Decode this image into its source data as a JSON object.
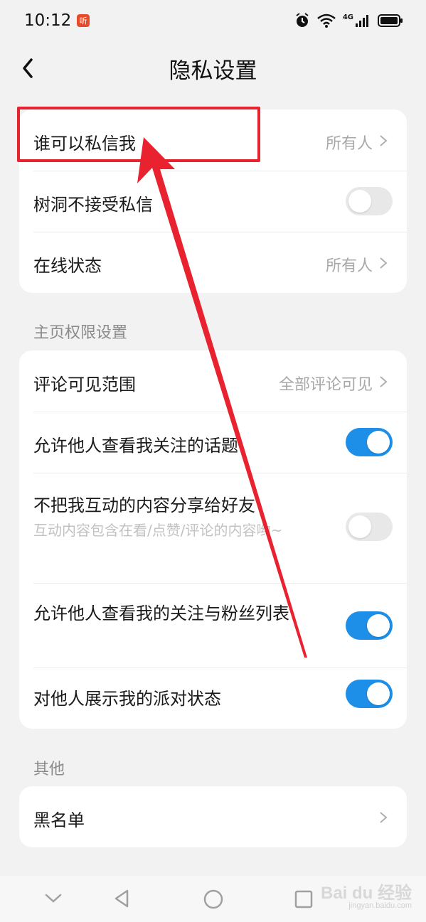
{
  "status_bar": {
    "time": "10:12",
    "notif_badge": "听",
    "network": "4G"
  },
  "header": {
    "title": "隐私设置"
  },
  "card1": {
    "who_can_message": {
      "label": "谁可以私信我",
      "value": "所有人"
    },
    "treehole": {
      "label": "树洞不接受私信",
      "toggle": "off"
    },
    "online_status": {
      "label": "在线状态",
      "value": "所有人"
    }
  },
  "section_homepage": "主页权限设置",
  "card2": {
    "comment_visibility": {
      "label": "评论可见范围",
      "value": "全部评论可见"
    },
    "allow_view_topics": {
      "label": "允许他人查看我关注的话题",
      "toggle": "on"
    },
    "no_share_interactions": {
      "label": "不把我互动的内容分享给好友",
      "sub": "互动内容包含在看/点赞/评论的内容哟~",
      "toggle": "off"
    },
    "allow_view_follow_list": {
      "label": "允许他人查看我的关注与粉丝列表",
      "toggle": "on"
    },
    "show_party_status": {
      "label": "对他人展示我的派对状态",
      "toggle": "on"
    }
  },
  "section_other": "其他",
  "card3": {
    "blacklist": {
      "label": "黑名单"
    }
  },
  "watermark": {
    "main": "Bai du 经验",
    "sub": "jingyan.baidu.com"
  },
  "colors": {
    "accent": "#1d8fe8",
    "annotation": "#e8222e",
    "background": "#f2f2f2"
  }
}
